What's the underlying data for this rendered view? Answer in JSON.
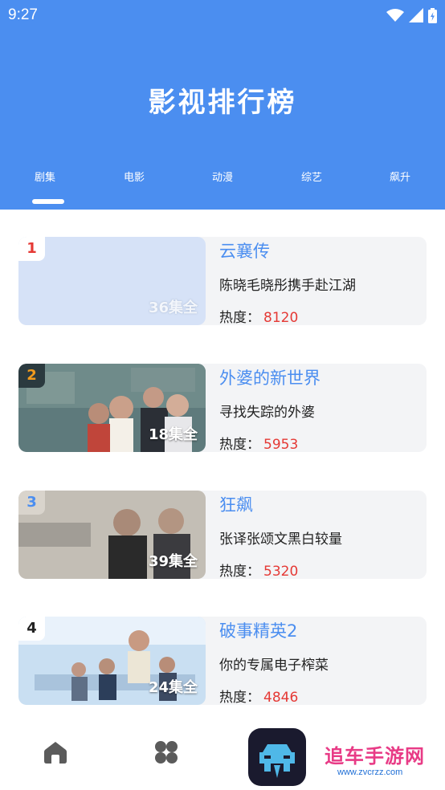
{
  "status_bar": {
    "time": "9:27"
  },
  "header": {
    "title": "影视排行榜"
  },
  "tabs": [
    {
      "label": "剧集",
      "active": true
    },
    {
      "label": "电影",
      "active": false
    },
    {
      "label": "动漫",
      "active": false
    },
    {
      "label": "综艺",
      "active": false
    },
    {
      "label": "飙升",
      "active": false
    }
  ],
  "list": [
    {
      "rank": "1",
      "title": "云襄传",
      "subtitle": "陈晓毛晓彤携手赴江湖",
      "heat_label": "热度：",
      "heat": "8120",
      "episodes": "36集全"
    },
    {
      "rank": "2",
      "title": "外婆的新世界",
      "subtitle": "寻找失踪的外婆",
      "heat_label": "热度：",
      "heat": "5953",
      "episodes": "18集全"
    },
    {
      "rank": "3",
      "title": "狂飙",
      "subtitle": "张译张颂文黑白较量",
      "heat_label": "热度：",
      "heat": "5320",
      "episodes": "39集全"
    },
    {
      "rank": "4",
      "title": "破事精英2",
      "subtitle": "你的专属电子榨菜",
      "heat_label": "热度：",
      "heat": "4846",
      "episodes": "24集全"
    }
  ],
  "bottom_nav": {
    "items": [
      {
        "icon": "home-icon"
      },
      {
        "icon": "grid-icon"
      }
    ]
  },
  "watermark": {
    "text": "追车手游网",
    "url": "www.zvcrzz.com"
  },
  "colors": {
    "primary": "#4b8ef0",
    "heat": "#e53935",
    "rank1": "#e53935",
    "rank2": "#f29b1d",
    "rank3": "#4b8ef0",
    "rank4": "#222222"
  }
}
